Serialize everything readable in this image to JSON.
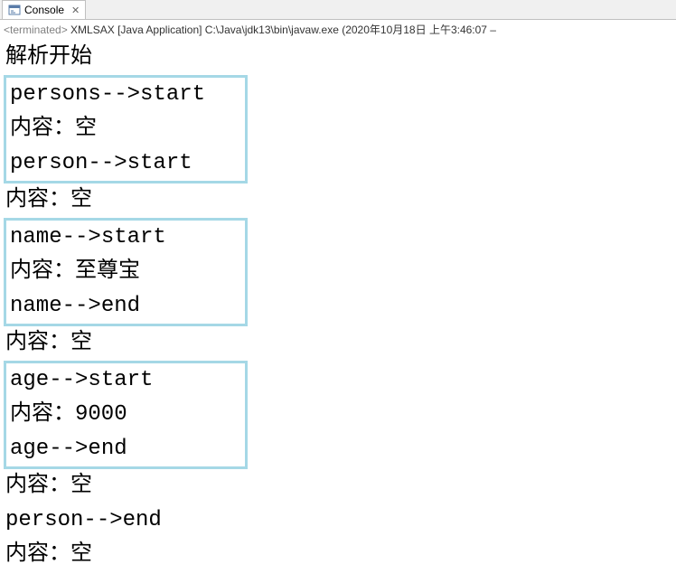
{
  "tab": {
    "label": "Console"
  },
  "status": {
    "terminated": "<terminated>",
    "text": " XMLSAX [Java Application] C:\\Java\\jdk13\\bin\\javaw.exe  (2020年10月18日 上午3:46:07 – "
  },
  "output": {
    "line_start": "解析开始",
    "box1_line1": "persons-->start",
    "box1_line2": "内容：空",
    "box1_line3": "person-->start",
    "line_after_box1": "内容：空",
    "box2_line1": "name-->start",
    "box2_line2": "内容：至尊宝",
    "box2_line3": "name-->end",
    "line_after_box2": "内容：空",
    "box3_line1": "age-->start",
    "box3_line2": "内容：9000",
    "box3_line3": "age-->end",
    "line_after_box3": "内容：空",
    "line_person_end": "person-->end",
    "line_last": "内容：空"
  }
}
